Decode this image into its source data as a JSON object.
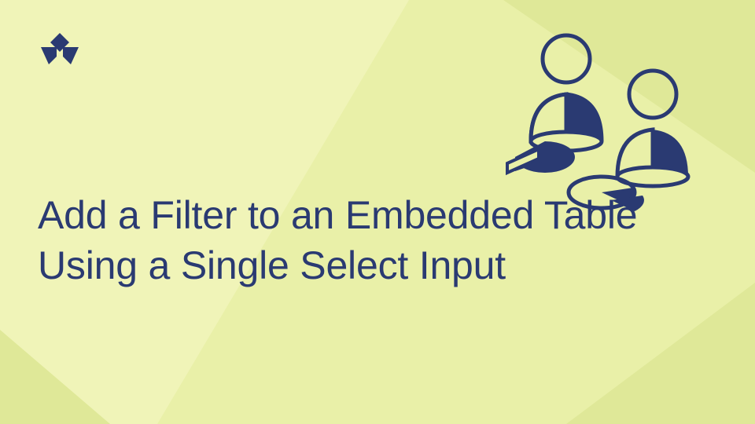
{
  "headline": "Add a Filter to an Embedded Table Using a Single Select Input",
  "colors": {
    "bg_base": "#e9f0a8",
    "bg_light": "#f0f4b8",
    "bg_dark": "#dfe898",
    "brand": "#2a3a72"
  }
}
